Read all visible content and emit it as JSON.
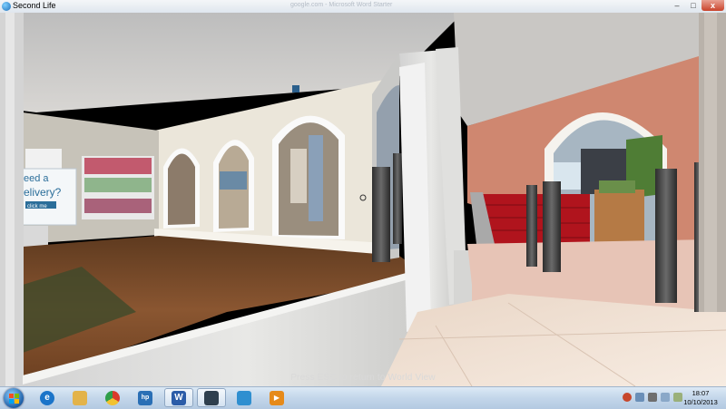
{
  "window": {
    "title": "Second Life",
    "ghost_title": "google.com - Microsoft Word Starter",
    "minimize_glyph": "–",
    "maximize_glyph": "□",
    "close_glyph": "x"
  },
  "viewer": {
    "esc_hint": "Press ESC to return to World View",
    "sign_text_1": "eed a",
    "sign_text_2": "elivery?",
    "sign_text_3": "click me"
  },
  "taskbar": {
    "apps": [
      {
        "name": "internet-explorer-icon",
        "glyph": "e",
        "color": "#1b74c9"
      },
      {
        "name": "file-explorer-icon",
        "glyph": "",
        "color": "#e3b34a"
      },
      {
        "name": "chrome-icon",
        "glyph": "",
        "color": "#d93b2b"
      },
      {
        "name": "hp-icon",
        "glyph": "hp",
        "color": "#2a6fb5"
      },
      {
        "name": "word-icon",
        "glyph": "W",
        "color": "#2b5ca8"
      },
      {
        "name": "second-life-icon",
        "glyph": "",
        "color": "#2e3f4e"
      },
      {
        "name": "photo-app-icon",
        "glyph": "",
        "color": "#2f8fd0"
      },
      {
        "name": "media-player-icon",
        "glyph": "▶",
        "color": "#e68a1a"
      }
    ],
    "time": "18:07",
    "date": "10/10/2013"
  },
  "colors": {
    "salmon_wall": "#cf8770",
    "red_stairs": "#b0141d",
    "wood_floor": "#7a4a26",
    "marble_floor": "#f0dfd0"
  }
}
